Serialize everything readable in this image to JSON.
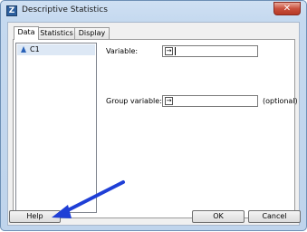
{
  "window": {
    "title": "Descriptive Statistics",
    "close_glyph": "✕",
    "app_icon": "Z"
  },
  "tabs": [
    {
      "label": "Data",
      "active": true
    },
    {
      "label": "Statistics",
      "active": false
    },
    {
      "label": "Display",
      "active": false
    }
  ],
  "variables": [
    {
      "name": "C1",
      "icon": "variable-triangle-icon"
    }
  ],
  "form": {
    "variable_label": "Variable:",
    "variable_value": "",
    "group_label": "Group variable:",
    "group_value": "",
    "optional_label": "(optional)",
    "arrow_glyph": "→"
  },
  "buttons": {
    "help": "Help",
    "ok": "OK",
    "cancel": "Cancel"
  },
  "colors": {
    "accent": "#2a62b8",
    "annotation_arrow": "#1f3fd6"
  }
}
